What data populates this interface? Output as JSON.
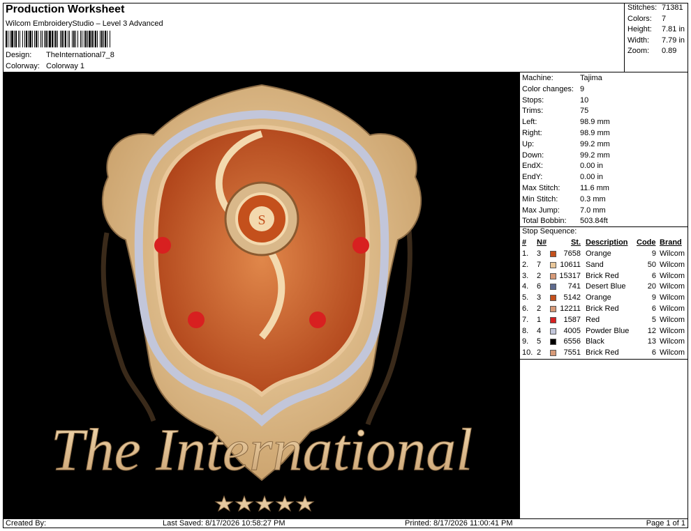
{
  "header": {
    "title": "Production Worksheet",
    "software": "Wilcom EmbroideryStudio – Level 3 Advanced",
    "design_label": "Design:",
    "design_value": "TheInternational7_8",
    "colorway_label": "Colorway:",
    "colorway_value": "Colorway 1"
  },
  "stats": [
    {
      "label": "Stitches:",
      "value": "71381"
    },
    {
      "label": "Colors:",
      "value": "7"
    },
    {
      "label": "Height:",
      "value": "7.81 in"
    },
    {
      "label": "Width:",
      "value": "7.79 in"
    },
    {
      "label": "Zoom:",
      "value": "0.89"
    }
  ],
  "machine_info": [
    {
      "label": "Machine:",
      "value": "Tajima"
    },
    {
      "label": "Color changes:",
      "value": "9"
    },
    {
      "label": "Stops:",
      "value": "10"
    },
    {
      "label": "Trims:",
      "value": "75"
    },
    {
      "label": "Left:",
      "value": "98.9 mm"
    },
    {
      "label": "Right:",
      "value": "98.9 mm"
    },
    {
      "label": "Up:",
      "value": "99.2 mm"
    },
    {
      "label": "Down:",
      "value": "99.2 mm"
    },
    {
      "label": "EndX:",
      "value": "0.00 in"
    },
    {
      "label": "EndY:",
      "value": "0.00 in"
    },
    {
      "label": "Max Stitch:",
      "value": "11.6 mm"
    },
    {
      "label": "Min Stitch:",
      "value": "0.3 mm"
    },
    {
      "label": "Max Jump:",
      "value": "7.0 mm"
    },
    {
      "label": "Total Bobbin:",
      "value": "503.84ft"
    }
  ],
  "stop_sequence": {
    "title": "Stop Sequence:",
    "headers": {
      "num": "#",
      "n": "N#",
      "st": "St.",
      "desc": "Description",
      "code": "Code",
      "brand": "Brand"
    },
    "rows": [
      {
        "num": "1.",
        "n": "3",
        "color": "#c4501c",
        "st": "7658",
        "desc": "Orange",
        "code": "9",
        "brand": "Wilcom"
      },
      {
        "num": "2.",
        "n": "7",
        "color": "#e9c79a",
        "st": "10611",
        "desc": "Sand",
        "code": "50",
        "brand": "Wilcom"
      },
      {
        "num": "3.",
        "n": "2",
        "color": "#d79a78",
        "st": "15317",
        "desc": "Brick Red",
        "code": "6",
        "brand": "Wilcom"
      },
      {
        "num": "4.",
        "n": "6",
        "color": "#5e6a8e",
        "st": "741",
        "desc": "Desert Blue",
        "code": "20",
        "brand": "Wilcom"
      },
      {
        "num": "5.",
        "n": "3",
        "color": "#c4501c",
        "st": "5142",
        "desc": "Orange",
        "code": "9",
        "brand": "Wilcom"
      },
      {
        "num": "6.",
        "n": "2",
        "color": "#d79a78",
        "st": "12211",
        "desc": "Brick Red",
        "code": "6",
        "brand": "Wilcom"
      },
      {
        "num": "7.",
        "n": "1",
        "color": "#d82020",
        "st": "1587",
        "desc": "Red",
        "code": "5",
        "brand": "Wilcom"
      },
      {
        "num": "8.",
        "n": "4",
        "color": "#c2c6da",
        "st": "4005",
        "desc": "Powder Blue",
        "code": "12",
        "brand": "Wilcom"
      },
      {
        "num": "9.",
        "n": "5",
        "color": "#000000",
        "st": "6556",
        "desc": "Black",
        "code": "13",
        "brand": "Wilcom"
      },
      {
        "num": "10.",
        "n": "2",
        "color": "#d79a78",
        "st": "7551",
        "desc": "Brick Red",
        "code": "6",
        "brand": "Wilcom"
      }
    ]
  },
  "design_image": {
    "text": "The International"
  },
  "footer": {
    "created": "Created By:",
    "saved": "Last Saved: 8/17/2026 10:58:27 PM",
    "printed": "Printed: 8/17/2026 11:00:41 PM",
    "page": "Page 1 of 1"
  }
}
